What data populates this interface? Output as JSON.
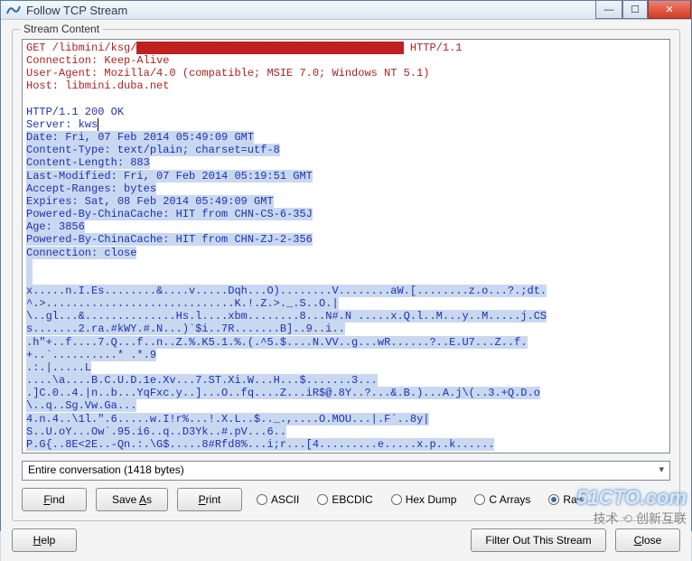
{
  "window": {
    "title": "Follow TCP Stream"
  },
  "group_label": "Stream Content",
  "request": {
    "line1_a": "GET /libmini/ksg/",
    "line1_b": " HTTP/1.1",
    "line2": "Connection: Keep-Alive",
    "line3": "User-Agent: Mozilla/4.0 (compatible; MSIE 7.0; Windows NT 5.1)",
    "line4": "Host: libmini.duba.net"
  },
  "response": {
    "l1": "HTTP/1.1 200 OK",
    "l2a": "Server: kws",
    "l3": "Date: Fri, 07 Feb 2014 05:49:09 GMT",
    "l4": "Content-Type: text/plain; charset=utf-8",
    "l5": "Content-Length: 883",
    "l6": "Last-Modified: Fri, 07 Feb 2014 05:19:51 GMT",
    "l7": "Accept-Ranges: bytes",
    "l8": "Expires: Sat, 08 Feb 2014 05:49:09 GMT",
    "l9": "Powered-By-ChinaCache: HIT from CHN-CS-6-35J",
    "l10": "Age: 3856",
    "l11": "Powered-By-ChinaCache: HIT from CHN-ZJ-2-356",
    "l12": "Connection: close",
    "b1": "x.....n.I.Es........&....v.....Dqh...O)........V........aW.[........z.o...?.;dt.",
    "b2": "^.>.............................K.!.Z.>._.S..O.|",
    "b3": "\\..gl...&..............Hs.l....xbm........8...N#.N .....x.Q.l..M...y..M.....j.CS",
    "b4": "s.......2.ra.#kWY.#.N...)`$i..7R.......B]..9..i..",
    "b5": ".h\"+..f....7.Q...f..n..Z.%.K5.1.%.(.^5.$....N.VV..g...wR......?..E.U7...Z..f.",
    "b6": "+..`..........* .*.9",
    "b7": ".:.|.....L",
    "b8": "....\\a....B.C.U.D.1e.Xv...7.ST.Xi.W...H...$.......3...",
    "b9": ".]C.0..4.|n..b...YqFxc.y..]...O..fq....Z...iR$@.8Y..?...&.B.)...A.j\\(..3.+Q.D.o",
    "b10": "\\..q..Sg.Vw.Ga...",
    "b11": "4.n.4..\\1l.\".6.....w.I!r%...!.X.L..$.._.,....O.MOU...|.F`..8y|",
    "b12": "S..U.oY...Ow`.95.i6..q..D3Yk..#.pV...6..",
    "b13": "P.G{..8E<2E..-Qn.:.\\G$.....8#Rfd8%...i;r...[4.........e.....x.p..k......"
  },
  "conversation_label": "Entire conversation (1418 bytes)",
  "buttons": {
    "find": "Find",
    "find_u": "F",
    "find_rest": "ind",
    "saveas_pre": "Save ",
    "saveas_u": "A",
    "saveas_post": "s",
    "print_u": "P",
    "print_rest": "rint",
    "help_u": "H",
    "help_rest": "elp",
    "filter": "Filter Out This Stream",
    "close_u": "C",
    "close_rest": "lose"
  },
  "radios": {
    "ascii": "ASCII",
    "ebcdic": "EBCDIC",
    "hex": "Hex Dump",
    "carr": "C Arrays",
    "raw": "Raw"
  },
  "watermarks": {
    "w1": "51CTO.com",
    "w2_a": "技术",
    "w2_b": "创新互联"
  }
}
